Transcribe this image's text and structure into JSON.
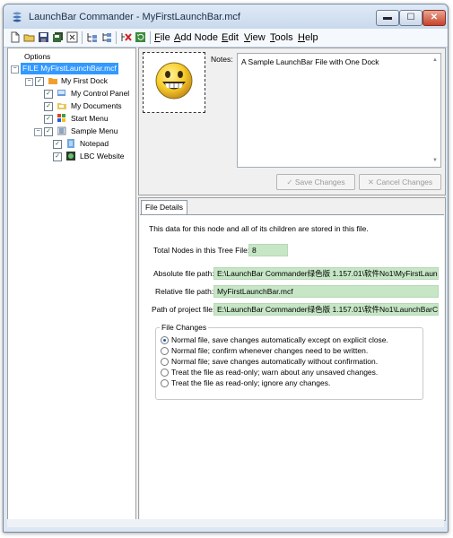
{
  "window": {
    "title": "LaunchBar Commander - MyFirstLaunchBar.mcf",
    "controls": {
      "minimize": "▬",
      "maximize": "☐",
      "close": "✕"
    }
  },
  "toolbar": {
    "icons": [
      "new-file-icon",
      "open-folder-icon",
      "save-icon",
      "save-all-icon",
      "close-doc-icon",
      "add-child-icon",
      "add-sibling-icon",
      "delete-node-icon",
      "refresh-icon"
    ]
  },
  "menu": {
    "items": [
      {
        "first": "F",
        "rest": "ile"
      },
      {
        "first": "A",
        "rest": "dd Node"
      },
      {
        "first": "E",
        "rest": "dit"
      },
      {
        "first": "V",
        "rest": "iew"
      },
      {
        "first": "T",
        "rest": "ools"
      },
      {
        "first": "H",
        "rest": "elp"
      }
    ]
  },
  "tree": {
    "options": "Options",
    "root": "FILE MyFirstLaunchBar.mcf",
    "dock": "My First Dock",
    "control_panel": "My Control Panel",
    "documents": "My Documents",
    "start_menu": "Start Menu",
    "sample_menu": "Sample Menu",
    "notepad": "Notepad",
    "website": "LBC Website"
  },
  "notes": {
    "label": "Notes:",
    "text": "A Sample LaunchBar File with One Dock"
  },
  "buttons": {
    "save": "Save Changes",
    "cancel": "Cancel Changes"
  },
  "details": {
    "tab": "File Details",
    "intro": "This data for this node and all of its children are stored in this file.",
    "total_label": "Total Nodes in this Tree File:",
    "total_value": "8",
    "abs_label": "Absolute file path:",
    "abs_value": "E:\\LaunchBar Commander绿色版 1.157.01\\软件No1\\MyFirstLaunc",
    "rel_label": "Relative file path:",
    "rel_value": "MyFirstLaunchBar.mcf",
    "proj_label": "Path of project file:",
    "proj_value": "E:\\LaunchBar Commander绿色版 1.157.01\\软件No1\\LaunchBarC"
  },
  "file_changes": {
    "title": "File Changes",
    "options": [
      "Normal file, save changes automatically except on explicit close.",
      "Normal file; confirm whenever changes need to be written.",
      "Normal file; save changes automatically without confirmation.",
      "Treat the file as read-only; warn about any unsaved changes.",
      "Treat the file as read-only; ignore any changes."
    ],
    "selected_index": 0
  },
  "colors": {
    "selection": "#3399ff",
    "field_bg": "#c6e6c6",
    "window_frame": "#dce7f3"
  }
}
